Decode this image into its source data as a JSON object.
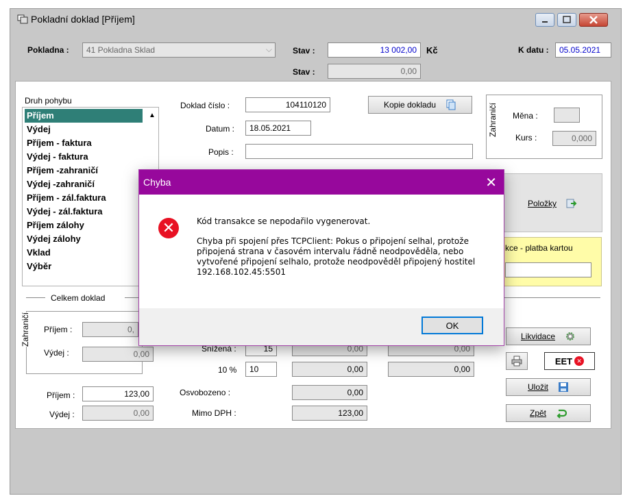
{
  "window": {
    "title": "Pokladní doklad [Příjem]"
  },
  "header": {
    "pokladna_label": "Pokladna :",
    "pokladna_value": "41 Pokladna Sklad",
    "stav_label": "Stav :",
    "stav_value": "13 002,00",
    "currency": "Kč",
    "stav2_label": "Stav :",
    "stav2_value": "0,00",
    "kdatu_label": "K datu :",
    "kdatu_value": "05.05.2021"
  },
  "druh": {
    "label": "Druh pohybu",
    "items": [
      "Příjem",
      "Výdej",
      "Příjem - faktura",
      "Výdej - faktura",
      "Příjem -zahraničí",
      "Výdej -zahraničí",
      "Příjem - zál.faktura",
      "Výdej - zál.faktura",
      "Příjem zálohy",
      "Výdej zálohy",
      "Vklad",
      "Výběr"
    ]
  },
  "doklad": {
    "cislo_label": "Doklad číslo :",
    "cislo_value": "104110120",
    "datum_label": "Datum :",
    "datum_value": "18.05.2021",
    "popis_label": "Popis :",
    "popis_value": "",
    "kopie_label": "Kopie dokladu"
  },
  "zahranici": {
    "tab": "Zahraničí",
    "mena_label": "Měna :",
    "mena_value": "",
    "kurs_label": "Kurs :",
    "kurs_value": "0,000"
  },
  "buttons": {
    "polozky": "Položky",
    "likvidace": "Likvidace",
    "ulozit": "Uložit",
    "zpet": "Zpět",
    "eet": "EET"
  },
  "yellow": {
    "label": "kce - platba kartou",
    "value": ""
  },
  "celkem": {
    "label": "Celkem doklad",
    "tab": "Zahraničí",
    "prijem_label": "Příjem :",
    "prijem_value": "0,",
    "vydej_label": "Výdej :",
    "vydej_value": "0,00",
    "prijem2_label": "Příjem :",
    "prijem2_value": "123,00",
    "vydej2_label": "Výdej :",
    "vydej2_value": "0,00"
  },
  "dph": {
    "snizena_label": "Snížená :",
    "snizena_rate": "15",
    "snizena_base": "0,00",
    "snizena_tax": "0,00",
    "r10_label": "10 %",
    "r10_rate": "10",
    "r10_base": "0,00",
    "r10_tax": "0,00",
    "osv_label": "Osvobozeno :",
    "osv_value": "0,00",
    "mimo_label": "Mimo DPH :",
    "mimo_value": "123,00"
  },
  "dialog": {
    "title": "Chyba",
    "line1": "Kód transakce se nepodařilo vygenerovat.",
    "line2": "Chyba při spojení přes TCPClient: Pokus o připojení selhal, protože připojená strana v časovém intervalu řádně neodpověděla, nebo vytvořené připojení selhalo, protože neodpověděl připojený hostitel 192.168.102.45:5501",
    "ok": "OK"
  }
}
